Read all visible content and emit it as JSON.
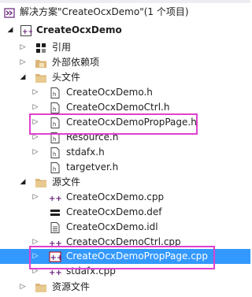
{
  "solution": {
    "label": "解决方案\"CreateOcxDemo\"(1 个项目)",
    "icon": "solution-icon"
  },
  "project": {
    "label": "CreateOcxDemo",
    "icon": "vc-project-icon"
  },
  "nodes": {
    "references": {
      "label": "引用",
      "icon": "references-icon"
    },
    "external_deps": {
      "label": "外部依赖项",
      "icon": "external-dependencies-icon"
    },
    "header_folder": {
      "label": "头文件",
      "icon": "folder-icon"
    },
    "source_folder": {
      "label": "源文件",
      "icon": "folder-icon"
    },
    "resource_folder": {
      "label": "资源文件",
      "icon": "folder-icon"
    }
  },
  "header_files": [
    {
      "label": "CreateOcxDemo.h"
    },
    {
      "label": "CreateOcxDemoCtrl.h"
    },
    {
      "label": "CreateOcxDemoPropPage.h"
    },
    {
      "label": "Resource.h"
    },
    {
      "label": "stdafx.h"
    },
    {
      "label": "targetver.h"
    }
  ],
  "source_files": [
    {
      "label": "CreateOcxDemo.cpp"
    },
    {
      "label": "CreateOcxDemo.def"
    },
    {
      "label": "CreateOcxDemo.idl"
    },
    {
      "label": "CreateOcxDemoCtrl.cpp"
    },
    {
      "label": "CreateOcxDemoPropPage.cpp"
    },
    {
      "label": "stdafx.cpp"
    }
  ],
  "colors": {
    "selection": "#3399ff",
    "highlight_box": "#e040d0",
    "folder": "#dcb67a",
    "cpp_icon": "#68217a"
  }
}
